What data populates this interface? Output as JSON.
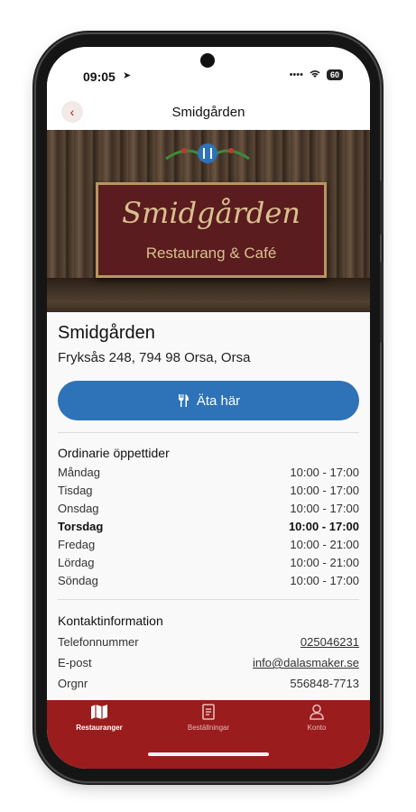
{
  "status_bar": {
    "time": "09:05",
    "battery": "60"
  },
  "nav": {
    "title": "Smidgården"
  },
  "hero": {
    "sign_title": "Smidgården",
    "sign_subtitle": "Restaurang & Café"
  },
  "restaurant": {
    "name": "Smidgården",
    "address": "Fryksås 248, 794 98 Orsa, Orsa",
    "eat_here_label": "Äta här"
  },
  "hours": {
    "title": "Ordinarie öppettider",
    "days": [
      {
        "day": "Måndag",
        "time": "10:00 - 17:00"
      },
      {
        "day": "Tisdag",
        "time": "10:00 - 17:00"
      },
      {
        "day": "Onsdag",
        "time": "10:00 - 17:00"
      },
      {
        "day": "Torsdag",
        "time": "10:00 - 17:00",
        "today": true
      },
      {
        "day": "Fredag",
        "time": "10:00 - 21:00"
      },
      {
        "day": "Lördag",
        "time": "10:00 - 21:00"
      },
      {
        "day": "Söndag",
        "time": "10:00 - 17:00"
      }
    ]
  },
  "contact": {
    "title": "Kontaktinformation",
    "rows": [
      {
        "label": "Telefonnummer",
        "value": "025046231"
      },
      {
        "label": "E-post",
        "value": "info@dalasmaker.se"
      },
      {
        "label": "Orgnr",
        "value": "556848-7713"
      }
    ]
  },
  "tabs": [
    {
      "label": "Restauranger",
      "icon": "map-icon"
    },
    {
      "label": "Beställningar",
      "icon": "receipt-icon"
    },
    {
      "label": "Konto",
      "icon": "user-icon"
    }
  ],
  "colors": {
    "brand": "#9a1c1c",
    "button": "#2e72b8"
  }
}
